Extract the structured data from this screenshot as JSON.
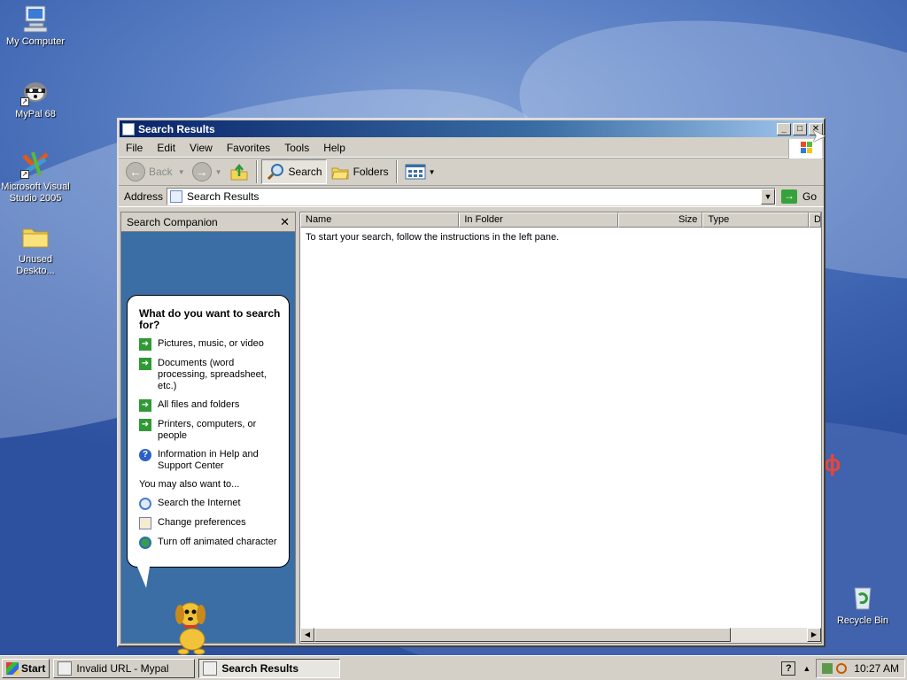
{
  "desktop": {
    "icons": [
      {
        "label": "My Computer",
        "icon": "my-computer-icon"
      },
      {
        "label": "MyPal 68",
        "icon": "mypal-raccoon-icon"
      },
      {
        "label": "Microsoft Visual Studio 2005",
        "icon": "visual-studio-icon"
      },
      {
        "label": "Unused Deskto...",
        "icon": "folder-icon"
      },
      {
        "label": "Recycle Bin",
        "icon": "recycle-bin-icon"
      }
    ]
  },
  "window": {
    "title": "Search Results",
    "menu": [
      "File",
      "Edit",
      "View",
      "Favorites",
      "Tools",
      "Help"
    ],
    "toolbar": {
      "back": "Back",
      "search": "Search",
      "folders": "Folders"
    },
    "address": {
      "label": "Address",
      "value": "Search Results",
      "go": "Go"
    }
  },
  "companion": {
    "header": "Search Companion",
    "question": "What do you want to search for?",
    "options": [
      "Pictures, music, or video",
      "Documents (word processing, spreadsheet, etc.)",
      "All files and folders",
      "Printers, computers, or people",
      "Information in Help and Support Center"
    ],
    "also_heading": "You may also want to...",
    "also": [
      "Search the Internet",
      "Change preferences",
      "Turn off animated character"
    ]
  },
  "results": {
    "columns": [
      "Name",
      "In Folder",
      "Size",
      "Type",
      "D"
    ],
    "empty_message": "To start your search, follow the instructions in the left pane."
  },
  "taskbar": {
    "start": "Start",
    "tasks": [
      {
        "label": "Invalid URL - Mypal",
        "active": false
      },
      {
        "label": "Search Results",
        "active": true
      }
    ],
    "help": "?",
    "clock": "10:27 AM"
  },
  "colors": {
    "title_active": "#0a246a",
    "companion_bg": "#3a6ea5",
    "desktop_bg": "#3c63b0"
  }
}
